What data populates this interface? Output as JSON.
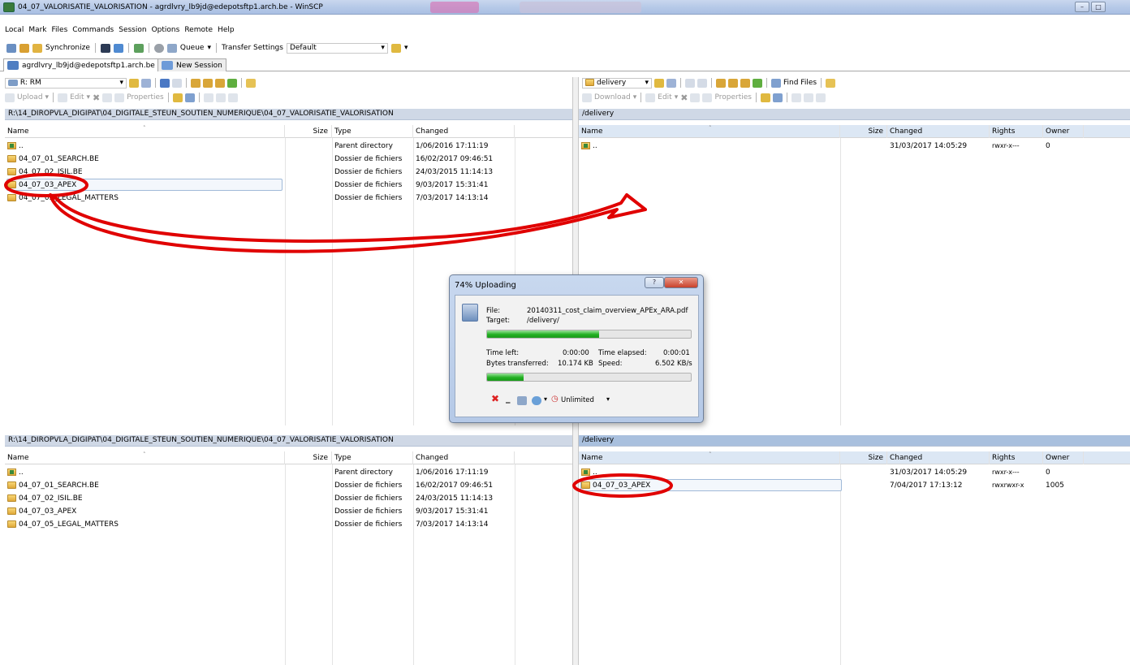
{
  "window": {
    "title": "04_07_VALORISATIE_VALORISATION - agrdlvry_lb9jd@edepotsftp1.arch.be - WinSCP",
    "min_glyph": "–",
    "max_glyph": "□"
  },
  "menu": [
    "Local",
    "Mark",
    "Files",
    "Commands",
    "Session",
    "Options",
    "Remote",
    "Help"
  ],
  "toolbar": {
    "synchronize": "Synchronize",
    "queue": "Queue",
    "transfer_settings_label": "Transfer Settings",
    "transfer_settings_value": "Default"
  },
  "tabs": {
    "session": "agrdlvry_lb9jd@edepotsftp1.arch.be",
    "new_session": "New Session"
  },
  "left_toolbar": {
    "drive": "R: RM",
    "upload": "Upload",
    "edit": "Edit",
    "properties": "Properties"
  },
  "right_toolbar": {
    "dir": "delivery",
    "find_files": "Find Files",
    "download": "Download",
    "edit": "Edit",
    "properties": "Properties"
  },
  "local_path": "R:\\14_DIROPVLA_DIGIPAT\\04_DIGITALE_STEUN_SOUTIEN_NUMERIQUE\\04_07_VALORISATIE_VALORISATION",
  "remote_path": "/delivery",
  "local_columns": [
    "Name",
    "Size",
    "Type",
    "Changed"
  ],
  "remote_columns": [
    "Name",
    "Size",
    "Changed",
    "Rights",
    "Owner"
  ],
  "local_files": [
    {
      "name": "..",
      "type": "Parent directory",
      "changed": "1/06/2016 17:11:19"
    },
    {
      "name": "04_07_01_SEARCH.BE",
      "type": "Dossier de fichiers",
      "changed": "16/02/2017 09:46:51"
    },
    {
      "name": "04_07_02_ISIL.BE",
      "type": "Dossier de fichiers",
      "changed": "24/03/2015 11:14:13"
    },
    {
      "name": "04_07_03_APEX",
      "type": "Dossier de fichiers",
      "changed": "9/03/2017 15:31:41"
    },
    {
      "name": "04_07_05_LEGAL_MATTERS",
      "type": "Dossier de fichiers",
      "changed": "7/03/2017 14:13:14"
    }
  ],
  "remote_files_top": [
    {
      "name": "..",
      "changed": "31/03/2017 14:05:29",
      "rights": "rwxr-x---",
      "owner": "0"
    }
  ],
  "remote_files_bottom": [
    {
      "name": "..",
      "changed": "31/03/2017 14:05:29",
      "rights": "rwxr-x---",
      "owner": "0"
    },
    {
      "name": "04_07_03_APEX",
      "changed": "7/04/2017 17:13:12",
      "rights": "rwxrwxr-x",
      "owner": "1005"
    }
  ],
  "dialog": {
    "title": "74% Uploading",
    "help_glyph": "?",
    "close_glyph": "✕",
    "file_label": "File:",
    "file_value": "20140311_cost_claim_overview_APEx_ARA.pdf",
    "target_label": "Target:",
    "target_value": "/delivery/",
    "time_left_label": "Time left:",
    "time_left_value": "0:00:00",
    "time_elapsed_label": "Time elapsed:",
    "time_elapsed_value": "0:00:01",
    "bytes_label": "Bytes transferred:",
    "bytes_value": "10.174 KB",
    "speed_label": "Speed:",
    "speed_value": "6.502 KB/s",
    "file_progress": 0.55,
    "total_progress": 0.18,
    "speed_limit": "Unlimited"
  },
  "colors": {
    "annotation": "#e00000",
    "selection_border": "#a0b9d8",
    "path_active": "#a9c0de"
  }
}
